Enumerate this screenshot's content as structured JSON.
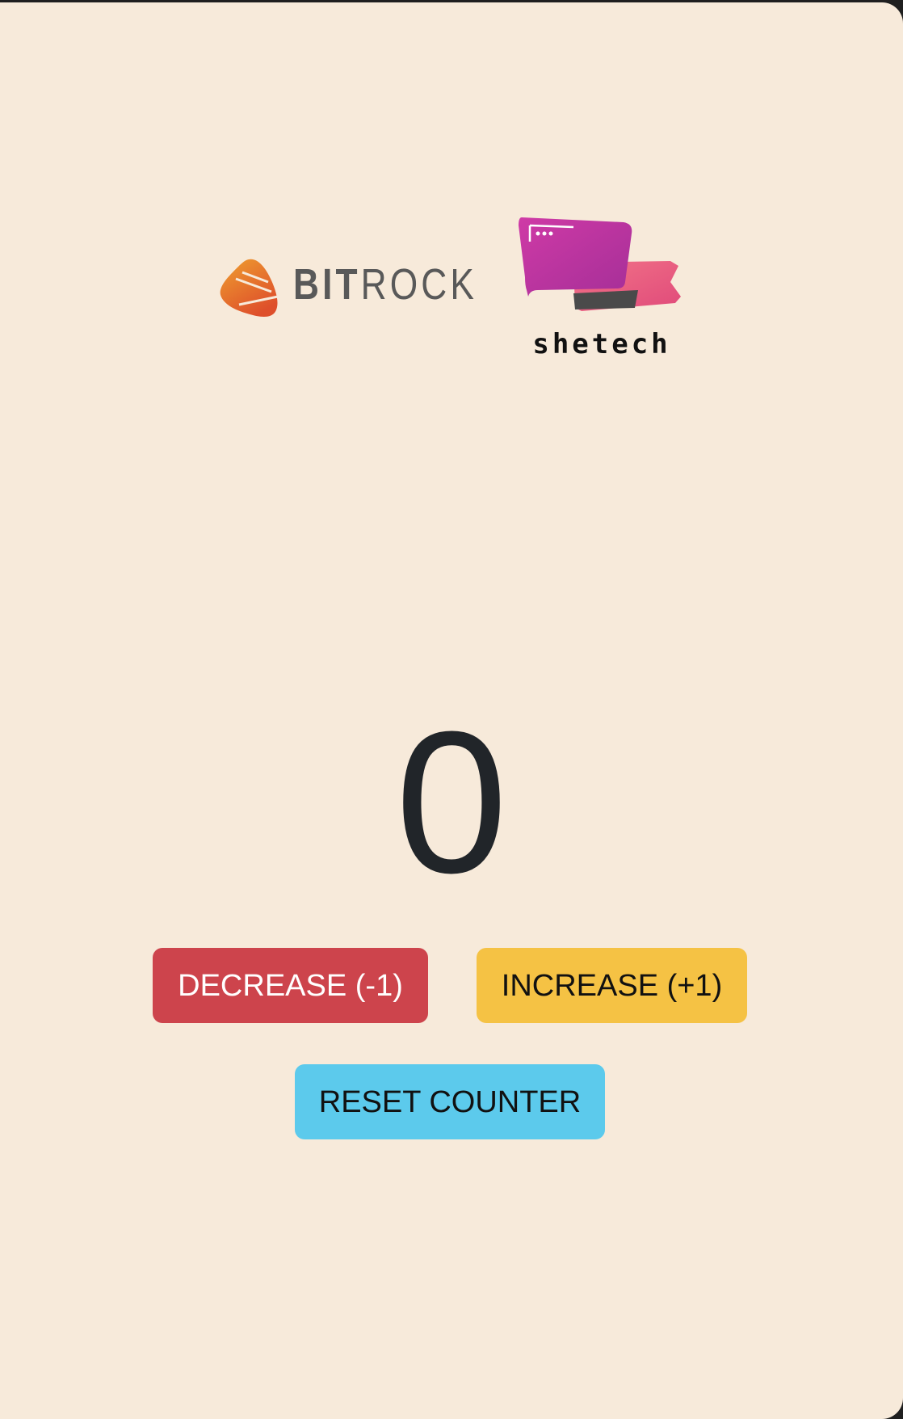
{
  "logos": {
    "bitrock": {
      "text_bold": "BIT",
      "text_light": "ROCK",
      "mark_color_top": "#ec9a2e",
      "mark_color_bottom": "#e0552a"
    },
    "shetech": {
      "text": "shetech",
      "card_front_color": "#c2309f",
      "card_back_color": "#e9607d"
    }
  },
  "counter": {
    "value": "0"
  },
  "buttons": {
    "decrease_label": "DECREASE (-1)",
    "increase_label": "INCREASE (+1)",
    "reset_label": "RESET COUNTER"
  },
  "colors": {
    "background": "#f7eada",
    "decrease": "#cd444c",
    "increase": "#f5c244",
    "reset": "#5ccaec",
    "counter_text": "#212529"
  }
}
